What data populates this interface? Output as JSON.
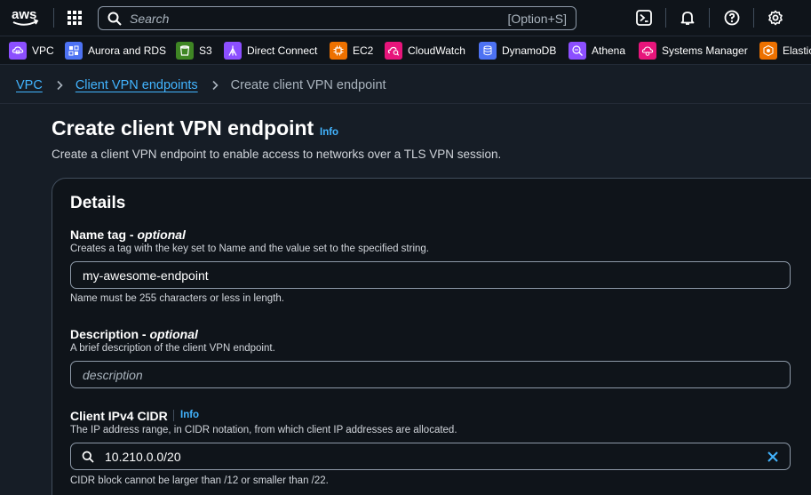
{
  "nav": {
    "logo_text": "aws",
    "search_placeholder": "Search",
    "search_shortcut": "[Option+S]"
  },
  "favorites": [
    {
      "label": "VPC",
      "icon": "vpc-icon",
      "color": "#8c4fff"
    },
    {
      "label": "Aurora and RDS",
      "icon": "rds-icon",
      "color": "#4d72f3"
    },
    {
      "label": "S3",
      "icon": "s3-icon",
      "color": "#3f8624"
    },
    {
      "label": "Direct Connect",
      "icon": "direct-connect-icon",
      "color": "#8c4fff"
    },
    {
      "label": "EC2",
      "icon": "ec2-icon",
      "color": "#ed7100"
    },
    {
      "label": "CloudWatch",
      "icon": "cloudwatch-icon",
      "color": "#e7157b"
    },
    {
      "label": "DynamoDB",
      "icon": "dynamodb-icon",
      "color": "#4d72f3"
    },
    {
      "label": "Athena",
      "icon": "athena-icon",
      "color": "#8c4fff"
    },
    {
      "label": "Systems Manager",
      "icon": "systems-manager-icon",
      "color": "#e7157b"
    },
    {
      "label": "Elastic",
      "icon": "elastic-icon",
      "color": "#ed7100"
    }
  ],
  "breadcrumb": {
    "items": [
      "VPC",
      "Client VPN endpoints"
    ],
    "current": "Create client VPN endpoint"
  },
  "page": {
    "title": "Create client VPN endpoint",
    "info": "Info",
    "description": "Create a client VPN endpoint to enable access to networks over a TLS VPN session."
  },
  "details": {
    "title": "Details",
    "name_tag": {
      "label": "Name tag",
      "optional": "optional",
      "hint": "Creates a tag with the key set to Name and the value set to the specified string.",
      "value": "my-awesome-endpoint",
      "constraint": "Name must be 255 characters or less in length."
    },
    "description_field": {
      "label": "Description",
      "optional": "optional",
      "hint": "A brief description of the client VPN endpoint.",
      "placeholder": "description"
    },
    "cidr": {
      "label": "Client IPv4 CIDR",
      "info": "Info",
      "hint": "The IP address range, in CIDR notation, from which client IP addresses are allocated.",
      "value": "10.210.0.0/20",
      "constraint": "CIDR block cannot be larger than /12 or smaller than /22."
    }
  },
  "colors": {
    "link": "#42b4ff",
    "background": "#161d26",
    "container": "#0f141a",
    "border": "#414d5c"
  }
}
